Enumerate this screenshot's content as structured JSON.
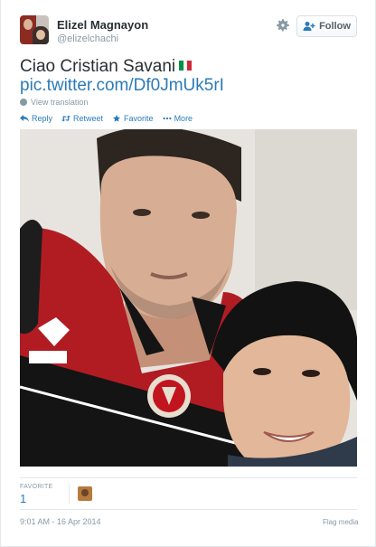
{
  "user": {
    "fullname": "Elizel Magnayon",
    "username": "@elizelchachi"
  },
  "header": {
    "follow_label": "Follow",
    "icons": [
      "gear-icon",
      "follow-person-icon"
    ]
  },
  "tweet": {
    "text": "Ciao Cristian Savani",
    "flag_colors": [
      "#009246",
      "#ffffff",
      "#ce2b37"
    ],
    "link": "pic.twitter.com/Df0JmUk5rI",
    "translation_label": "View translation"
  },
  "actions": {
    "reply": "Reply",
    "retweet": "Retweet",
    "favorite": "Favorite",
    "more": "More"
  },
  "stats": {
    "favorite_label": "FAVORITE",
    "favorite_count": "1"
  },
  "footer": {
    "timestamp": "9:01 AM - 16 Apr 2014",
    "flag_media": "Flag media"
  },
  "colors": {
    "link": "#2b7bb9",
    "muted": "#8899a6",
    "text": "#292f33"
  }
}
